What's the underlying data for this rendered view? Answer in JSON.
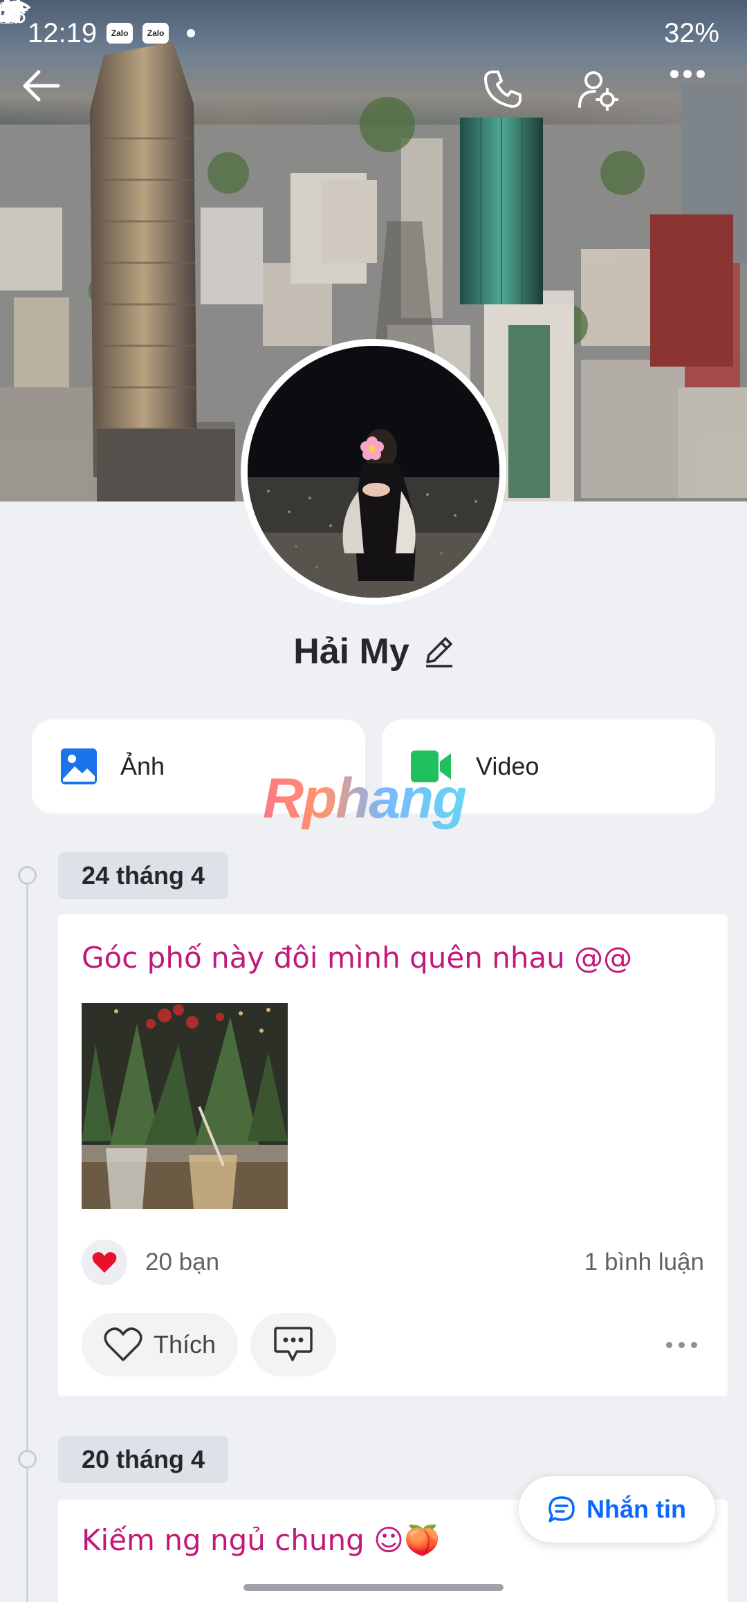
{
  "status_bar": {
    "time": "12:19",
    "badges": [
      "Zalo",
      "Zalo"
    ],
    "battery": "32%"
  },
  "nav": {
    "back_icon": "arrow-left-icon",
    "call_icon": "phone-icon",
    "settings_icon": "user-settings-icon",
    "more_icon": "more-horizontal-icon"
  },
  "profile": {
    "name": "Hải My",
    "edit_icon": "pencil-icon"
  },
  "quick_links": {
    "photos_label": "Ảnh",
    "video_label": "Video"
  },
  "watermark": "Rphang",
  "posts": [
    {
      "date": "24 tháng 4",
      "text": "Góc phố này đôi mình quên nhau @@",
      "reactions": "20 bạn",
      "comments": "1 bình luận",
      "like_label": "Thích"
    },
    {
      "date": "20 tháng 4",
      "text": "Kiếm ng ngủ chung ☺🍑"
    }
  ],
  "message_button": {
    "label": "Nhắn tin"
  },
  "colors": {
    "accent": "#0a68ff",
    "post_text": "#c2187a",
    "heart": "#e8112d",
    "background": "#eef0f4"
  }
}
